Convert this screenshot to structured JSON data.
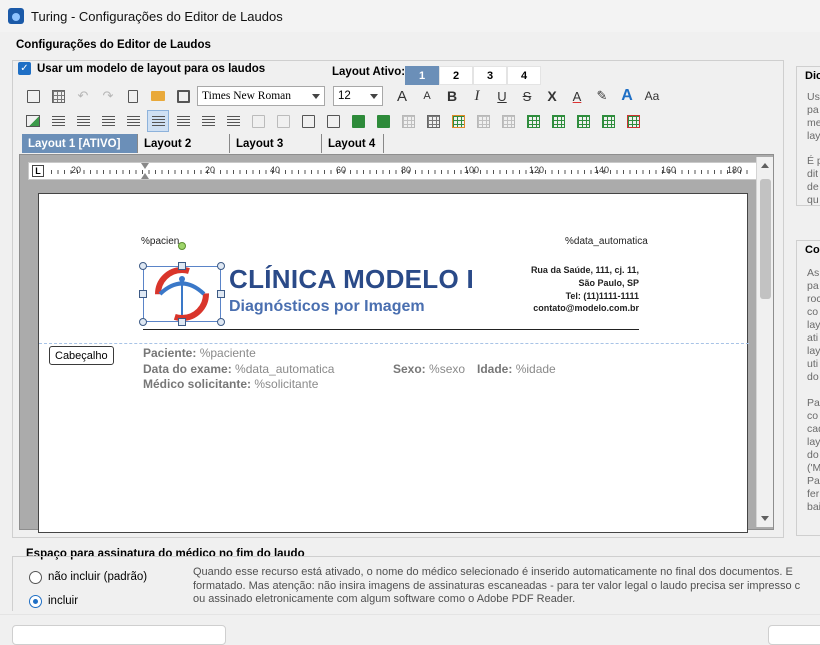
{
  "window": {
    "title": "Turing - Configurações do Editor de Laudos"
  },
  "section_title": "Configurações do Editor de Laudos",
  "use_layout_checkbox": {
    "label": "Usar um modelo de layout para os laudos",
    "checked": true
  },
  "layout_ativo": {
    "label": "Layout Ativo:",
    "options": [
      "1",
      "2",
      "3",
      "4"
    ],
    "selected": "1"
  },
  "toolbar": {
    "font": "Times New Roman",
    "size": "12",
    "grow_font": "A",
    "shrink_font": "A",
    "bold": "B",
    "italic": "I",
    "underline": "U",
    "strike": "S",
    "superscript": "X",
    "font_color": "A",
    "styles": "A"
  },
  "tabs": [
    "Layout 1 [ATIVO]",
    "Layout 2",
    "Layout 3",
    "Layout 4"
  ],
  "ruler": {
    "labels": [
      "20",
      "20",
      "40",
      "60",
      "80",
      "100",
      "120",
      "140",
      "160",
      "180"
    ],
    "corner": "L"
  },
  "document": {
    "patient_tag": "%pacien",
    "date_tag": "%data_automatica",
    "clinic_name": "CLÍNICA MODELO I",
    "clinic_subtitle": "Diagnósticos por Imagem",
    "address": [
      "Rua da Saúde, 111, cj. 11,",
      "São Paulo, SP",
      "Tel: (11)1111-1111",
      "contato@modelo.com.br"
    ],
    "header_label": "Cabeçalho",
    "fields": {
      "paciente_label": "Paciente:",
      "paciente_value": "%paciente",
      "data_label": "Data do exame:",
      "data_value": "%data_automatica",
      "sexo_label": "Sexo:",
      "sexo_value": "%sexo",
      "idade_label": "Idade:",
      "idade_value": "%idade",
      "medico_label": "Médico solicitante:",
      "medico_value": "%solicitante"
    }
  },
  "signature": {
    "title": "Espaço para assinatura do médico no fim do laudo",
    "options": [
      "não incluir (padrão)",
      "incluir"
    ],
    "selected": "incluir",
    "description": [
      "Quando esse recurso está ativado, o nome do médico selecionado é inserido automaticamente no final dos documentos. E",
      "formatado. Mas atenção: não insira imagens de assinaturas escaneadas - para ter valor legal o laudo precisa ser impresso c",
      "ou assinado eletronicamente com algum software como o Adobe PDF Reader."
    ]
  },
  "side_panel_1": {
    "title": "Dic",
    "body": [
      "Us",
      "pa",
      "me",
      "lay",
      "",
      "É p",
      "dit",
      "de",
      "qu"
    ]
  },
  "side_panel_2": {
    "title": "Co",
    "body": [
      "As",
      "pa",
      "roc",
      "co",
      "lay",
      "ati",
      "lay",
      "uti",
      "do",
      "",
      "Par",
      "co",
      "cad",
      "lay",
      "do",
      "('M",
      "Pap",
      "fer",
      "bai"
    ]
  },
  "colors": {
    "accent": "#1f6fc5",
    "tab_active": "#6b8fb8",
    "clinic_blue": "#2a4a88",
    "logo_red": "#d9352b"
  }
}
